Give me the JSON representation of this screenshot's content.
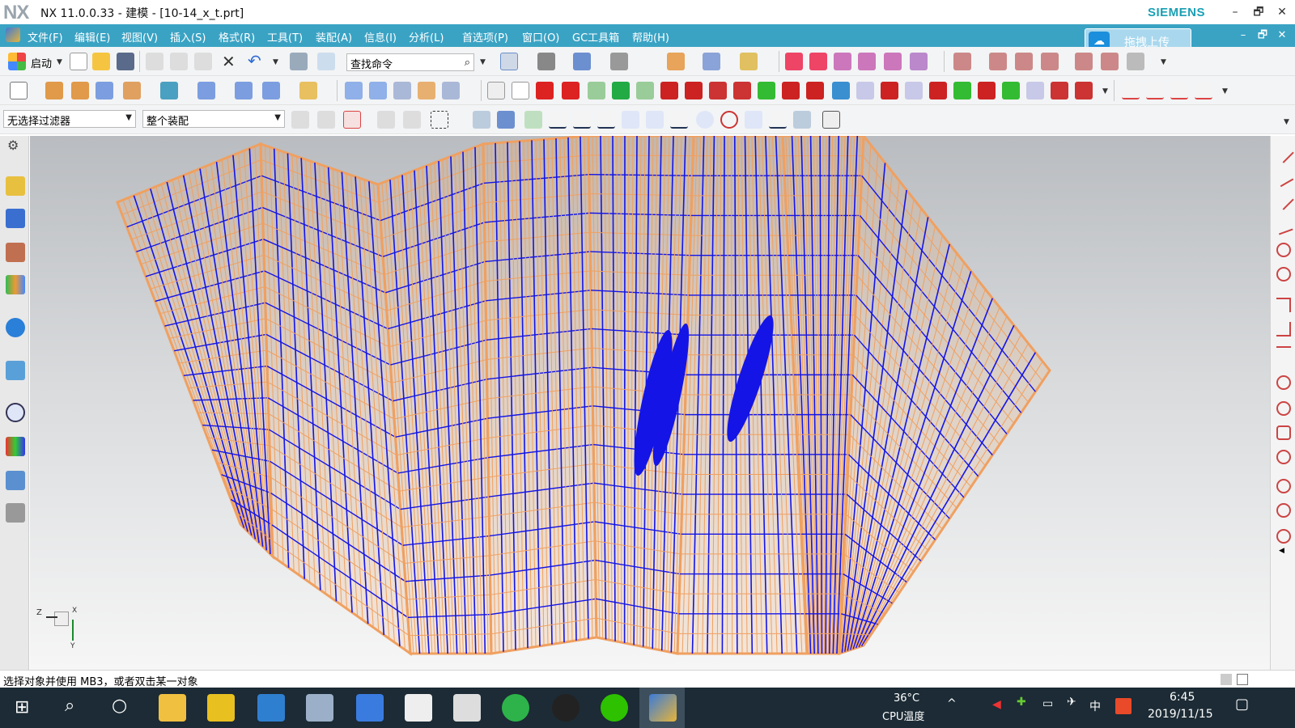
{
  "window": {
    "logo": "NX",
    "title": "NX 11.0.0.33 - 建模 - [10-14_x_t.prt]",
    "brand": "SIEMENS",
    "buttons": [
      "–",
      "🗗",
      "✕"
    ]
  },
  "menu": {
    "items": [
      "文件(F)",
      "编辑(E)",
      "视图(V)",
      "插入(S)",
      "格式(R)",
      "工具(T)",
      "装配(A)",
      "信息(I)",
      "分析(L)",
      "首选项(P)",
      "窗口(O)",
      "GC工具箱",
      "帮助(H)"
    ],
    "upload_label": "拖拽上传",
    "mdi_buttons": [
      "–",
      "🗗",
      "✕"
    ]
  },
  "toolbar1": {
    "start_label": "启动",
    "search_placeholder": "查找命令"
  },
  "selection_bar": {
    "filter_value": "无选择过滤器",
    "scope_value": "整个装配"
  },
  "triad": {
    "z_label": "Z",
    "x_label": "X",
    "y_label": "Y"
  },
  "status": {
    "prompt": "选择对象并使用 MB3，或者双击某一对象"
  },
  "taskbar": {
    "temperature": "36°C",
    "temp_caption": "CPU温度",
    "ime": "中",
    "time": "6:45",
    "date": "2019/11/15"
  },
  "colors": {
    "menubar": "#3aa3c4",
    "mesh_orange": "#f0a060",
    "mesh_blue": "#1414e6",
    "brand": "#1aa0b4",
    "taskbar": "#1c2b35"
  }
}
